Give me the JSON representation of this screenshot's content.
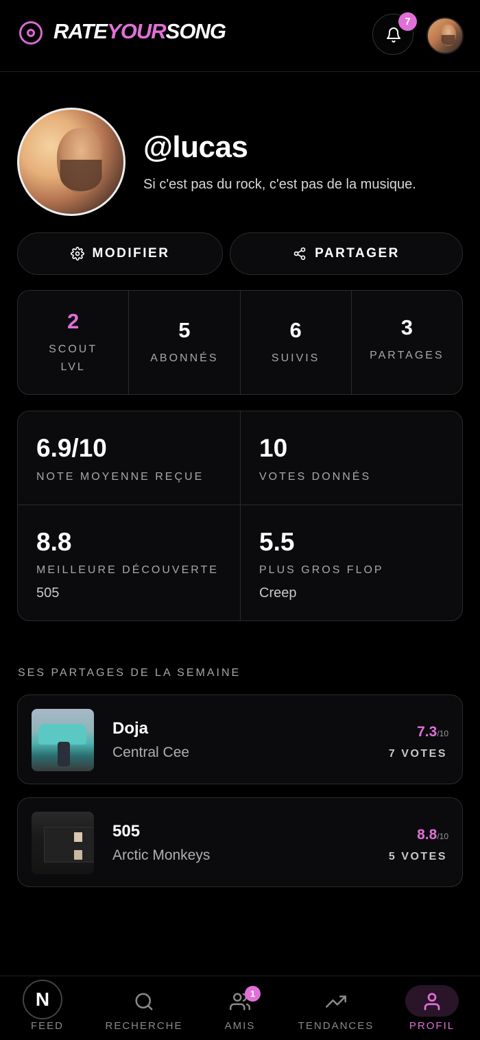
{
  "header": {
    "logo_part1": "RATE",
    "logo_part2": "YOUR",
    "logo_part3": "SONG",
    "notification_count": "7"
  },
  "profile": {
    "username": "@lucas",
    "bio": "Si c'est pas du rock, c'est pas de la musique.",
    "edit_label": "MODIFIER",
    "share_label": "PARTAGER"
  },
  "stats": [
    {
      "value": "2",
      "label": "SCOUT LVL"
    },
    {
      "value": "5",
      "label": "ABONNÉS"
    },
    {
      "value": "6",
      "label": "SUIVIS"
    },
    {
      "value": "3",
      "label": "PARTAGES"
    }
  ],
  "metrics": [
    {
      "value": "6.9/10",
      "label": "NOTE MOYENNE REÇUE",
      "sub": ""
    },
    {
      "value": "10",
      "label": "VOTES DONNÉS",
      "sub": ""
    },
    {
      "value": "8.8",
      "label": "MEILLEURE DÉCOUVERTE",
      "sub": "505"
    },
    {
      "value": "5.5",
      "label": "PLUS GROS FLOP",
      "sub": "Creep"
    }
  ],
  "weekly": {
    "title": "SES PARTAGES DE LA SEMAINE",
    "songs": [
      {
        "title": "Doja",
        "artist": "Central Cee",
        "score": "7.3",
        "scale": "/10",
        "votes": "7 VOTES"
      },
      {
        "title": "505",
        "artist": "Arctic Monkeys",
        "score": "8.8",
        "scale": "/10",
        "votes": "5 VOTES"
      }
    ]
  },
  "nav": {
    "feed_glyph": "N",
    "feed": "FEED",
    "recherche": "RECHERCHE",
    "amis": "AMIS",
    "amis_badge": "1",
    "tendances": "TENDANCES",
    "profil": "PROFIL"
  },
  "colors": {
    "accent": "#e070d8",
    "background": "#000000",
    "card": "#0b0b0d",
    "border": "#2c2c2c"
  }
}
